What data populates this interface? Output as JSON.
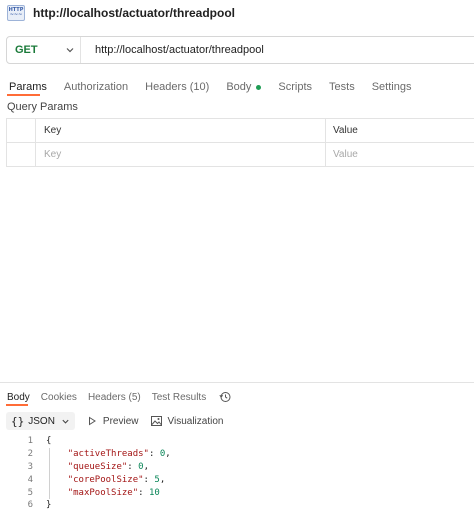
{
  "request": {
    "title": "http://localhost/actuator/threadpool",
    "method": "GET",
    "url": "http://localhost/actuator/threadpool"
  },
  "tabs": {
    "params": "Params",
    "authorization": "Authorization",
    "headers": "Headers",
    "headers_count": "(10)",
    "body": "Body",
    "scripts": "Scripts",
    "tests": "Tests",
    "settings": "Settings"
  },
  "query_params": {
    "label": "Query Params",
    "columns": [
      "Key",
      "Value"
    ],
    "placeholder_row": [
      "Key",
      "Value"
    ]
  },
  "response": {
    "tabs": [
      "Body",
      "Cookies",
      "Headers (5)",
      "Test Results"
    ],
    "format": "JSON",
    "preview": "Preview",
    "visualization": "Visualization",
    "lines": [
      {
        "no": "1",
        "text": "{"
      },
      {
        "no": "2",
        "key": "\"activeThreads\"",
        "value": "0",
        "comma": ","
      },
      {
        "no": "3",
        "key": "\"queueSize\"",
        "value": "0",
        "comma": ","
      },
      {
        "no": "4",
        "key": "\"corePoolSize\"",
        "value": "5",
        "comma": ","
      },
      {
        "no": "5",
        "key": "\"maxPoolSize\"",
        "value": "10",
        "comma": ""
      },
      {
        "no": "6",
        "text": "}"
      }
    ]
  },
  "colors": {
    "accent": "#ff6c37",
    "method_get": "#1b7a3a",
    "body_dot": "#1f9d55",
    "json_key": "#a31515",
    "json_number": "#098658"
  },
  "icons": [
    "http-request-icon",
    "chevron-down-icon",
    "history-icon",
    "play-icon",
    "image-icon"
  ]
}
